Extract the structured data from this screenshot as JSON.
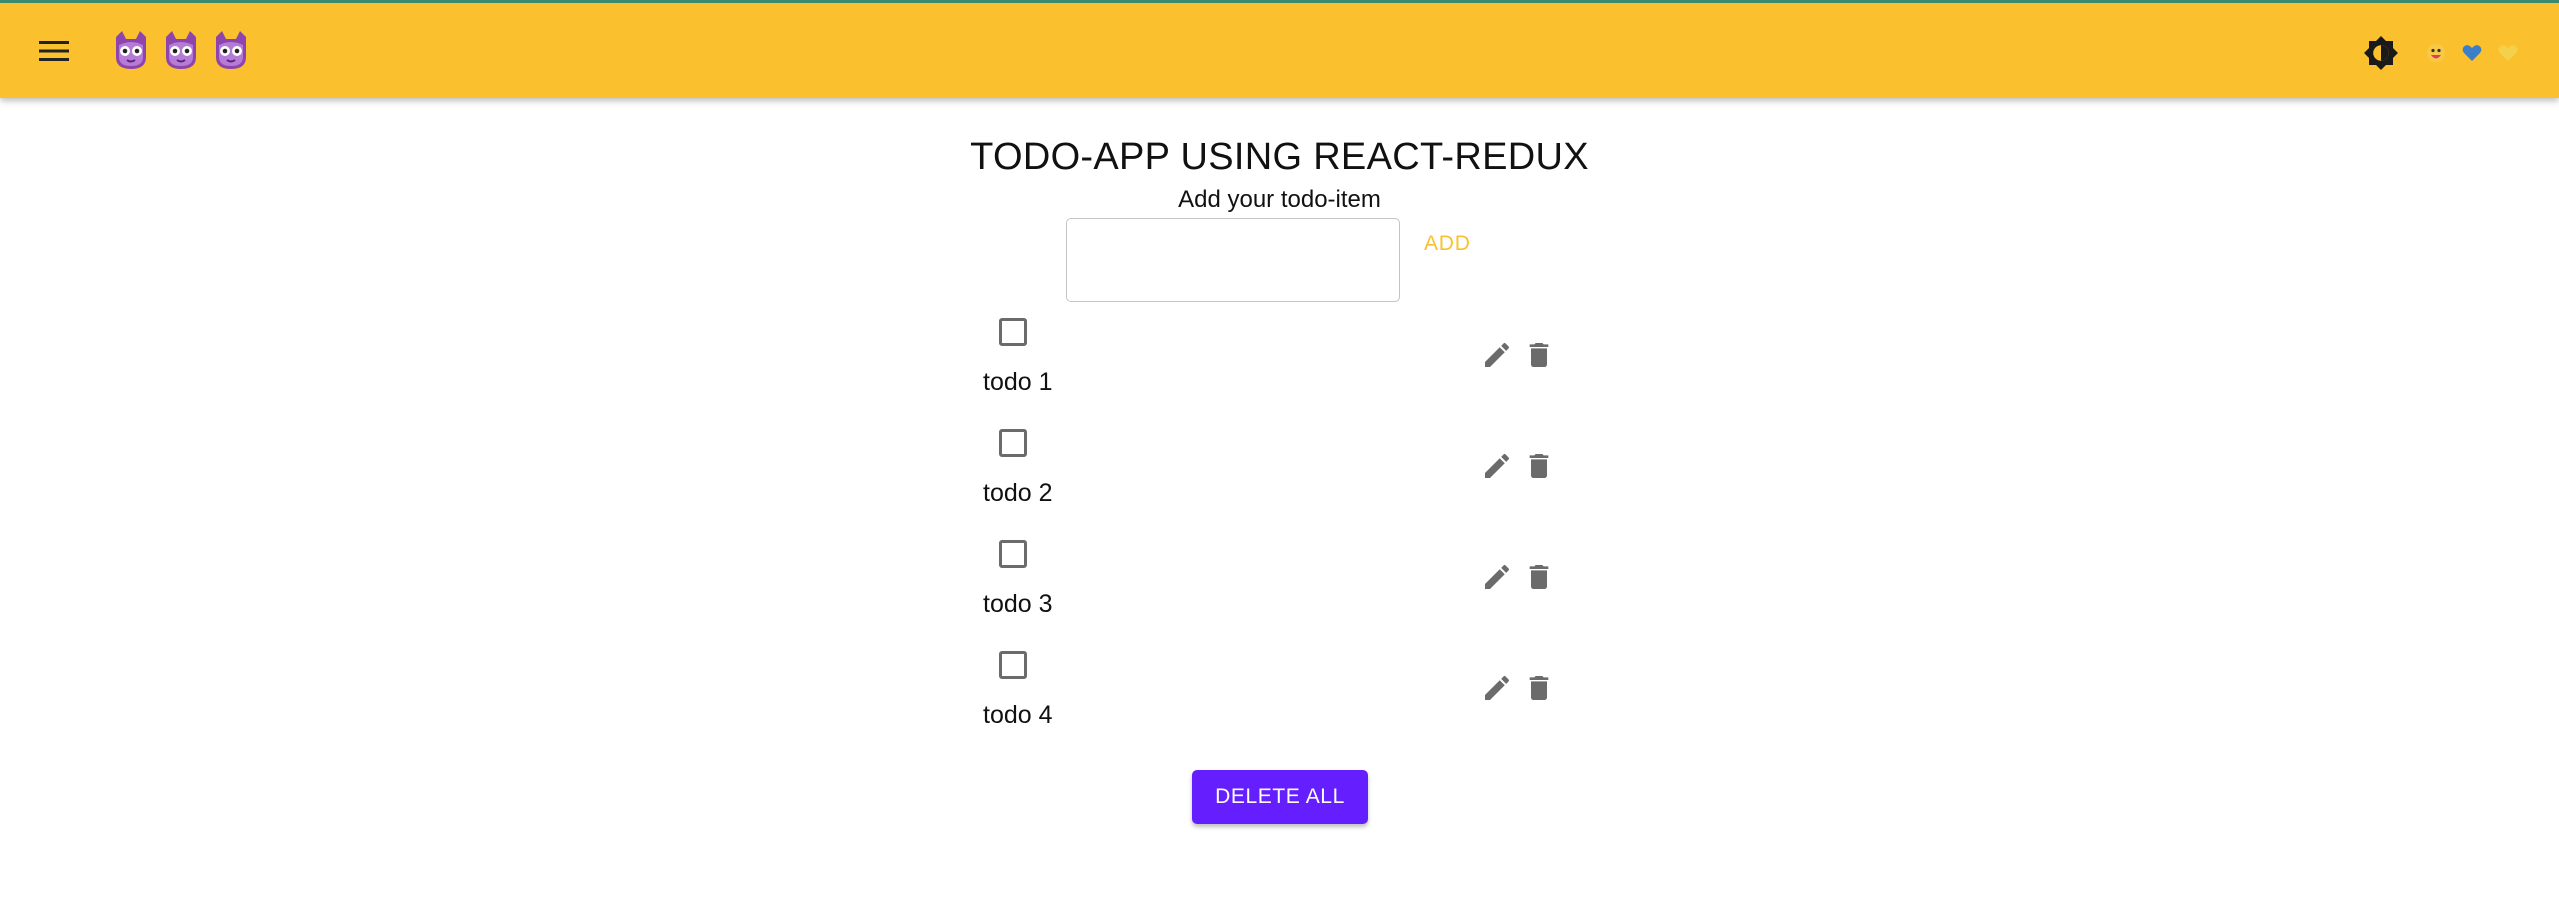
{
  "appbar": {
    "menu_icon": "menu-icon",
    "avatars": [
      "cat-avatar-icon",
      "cat-avatar-icon",
      "cat-avatar-icon"
    ],
    "theme_icon": "brightness-icon",
    "hearts": [
      {
        "icon": "heart-emoji-icon",
        "color": "#e53965"
      },
      {
        "icon": "blue-heart-icon",
        "color": "#3a7fc8"
      },
      {
        "icon": "yellow-heart-icon",
        "color": "#f5d04a"
      }
    ],
    "background": "#fbc02d"
  },
  "main": {
    "title": "TODO-APP USING REACT-REDUX",
    "subtitle": "Add your todo-item",
    "input_value": "",
    "add_label": "ADD",
    "todos": [
      {
        "label": "todo 1",
        "checked": false
      },
      {
        "label": "todo 2",
        "checked": false
      },
      {
        "label": "todo 3",
        "checked": false
      },
      {
        "label": "todo 4",
        "checked": false
      }
    ],
    "edit_icon": "pencil-icon",
    "delete_icon": "trash-icon",
    "delete_all_label": "DELETE ALL"
  },
  "colors": {
    "accent": "#fbc02d",
    "primary_button": "#651fff",
    "icon_gray": "#6b6b6b"
  }
}
